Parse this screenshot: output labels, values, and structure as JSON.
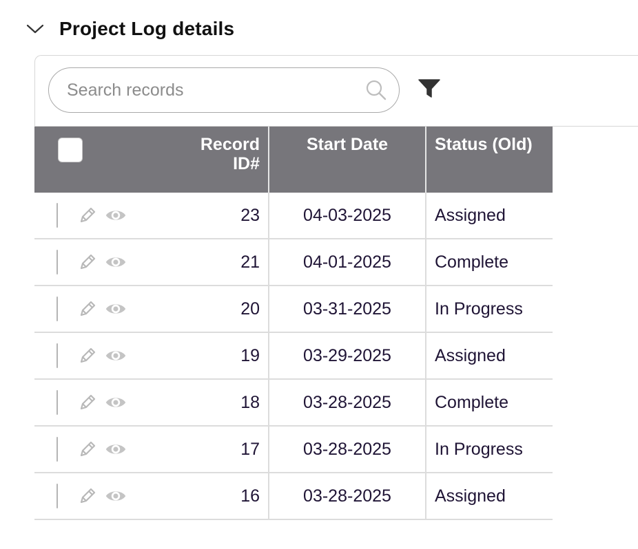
{
  "section": {
    "title": "Project Log details",
    "collapse_icon": "chevron-down-icon"
  },
  "toolbar": {
    "search_placeholder": "Search records",
    "search_icon": "search-icon",
    "filter_icon": "filter-icon"
  },
  "table": {
    "columns": {
      "record_id_line1": "Record",
      "record_id_line2": "ID#",
      "start_date": "Start Date",
      "status_old": "Status (Old)"
    },
    "row_action_icons": [
      "pencil-icon",
      "eye-icon"
    ],
    "rows": [
      {
        "id": "23",
        "start_date": "04-03-2025",
        "status": "Assigned"
      },
      {
        "id": "21",
        "start_date": "04-01-2025",
        "status": "Complete"
      },
      {
        "id": "20",
        "start_date": "03-31-2025",
        "status": "In Progress"
      },
      {
        "id": "19",
        "start_date": "03-29-2025",
        "status": "Assigned"
      },
      {
        "id": "18",
        "start_date": "03-28-2025",
        "status": "Complete"
      },
      {
        "id": "17",
        "start_date": "03-28-2025",
        "status": "In Progress"
      },
      {
        "id": "16",
        "start_date": "03-28-2025",
        "status": "Assigned"
      }
    ]
  },
  "colors": {
    "header_bg": "#77767b",
    "text": "#1f1435",
    "icon_muted": "#b8b8b8"
  }
}
